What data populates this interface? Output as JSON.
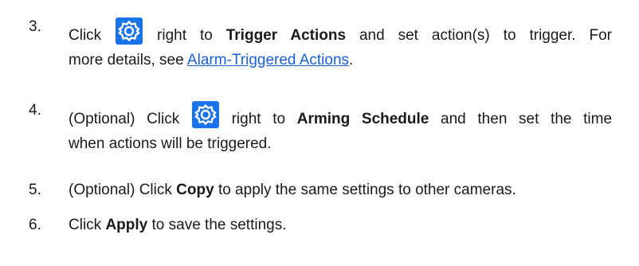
{
  "steps": [
    {
      "number": "3.",
      "line1": {
        "pre": "Click",
        "bold": "Trigger Actions",
        "mid": "right to",
        "post": "and set action(s) to trigger. For"
      },
      "line2": {
        "pre": "more details, see",
        "link": "Alarm-Triggered Actions",
        "post": "."
      },
      "icon": "gear-settings-icon"
    },
    {
      "number": "4.",
      "line1": {
        "pre": "(Optional) Click",
        "mid": "right to",
        "bold": "Arming Schedule",
        "post": "and then set the time"
      },
      "line2": {
        "text": "when actions will be triggered."
      },
      "icon": "gear-settings-icon"
    },
    {
      "number": "5.",
      "line1": {
        "pre": "(Optional) Click",
        "bold": "Copy",
        "post": "to apply the same settings to other cameras."
      }
    },
    {
      "number": "6.",
      "line1": {
        "pre": "Click",
        "bold": "Apply",
        "post": "to save the settings."
      }
    }
  ],
  "colors": {
    "text": "#1a1a1a",
    "link": "#1a5fd6",
    "icon_bg": "#1a73e8",
    "icon_fg": "#ffffff"
  }
}
